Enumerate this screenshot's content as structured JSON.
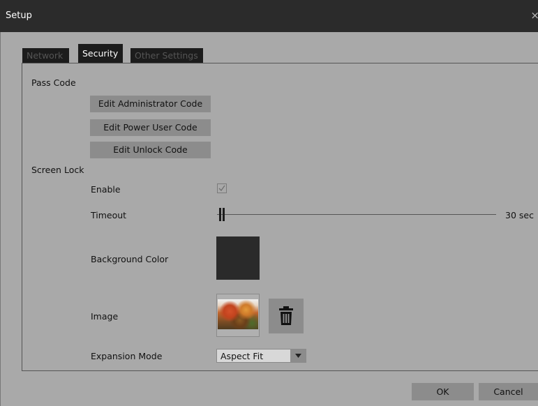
{
  "window": {
    "title": "Setup",
    "close_glyph": "×"
  },
  "tabs": [
    {
      "label": "Network",
      "active": false
    },
    {
      "label": "Security",
      "active": true
    },
    {
      "label": "Other Settings",
      "active": false
    }
  ],
  "pass_code": {
    "heading": "Pass Code",
    "buttons": {
      "admin": "Edit Administrator Code",
      "power_user": "Edit Power User Code",
      "unlock": "Edit Unlock Code"
    }
  },
  "screen_lock": {
    "heading": "Screen Lock",
    "enable_label": "Enable",
    "enable_checked": true,
    "timeout_label": "Timeout",
    "timeout_value": "30 sec",
    "background_color_label": "Background Color",
    "background_color": "#2a2a2a",
    "image_label": "Image",
    "image_icon": "landscape-thumbnail",
    "delete_icon": "trash-icon",
    "expansion_mode_label": "Expansion Mode",
    "expansion_mode_value": "Aspect Fit"
  },
  "footer": {
    "ok_label": "OK",
    "cancel_label": "Cancel"
  },
  "colors": {
    "titlebar": "#2b2b2b",
    "background": "#a9a9a9",
    "button": "#8c8c8c",
    "tab": "#1c1c1c"
  }
}
